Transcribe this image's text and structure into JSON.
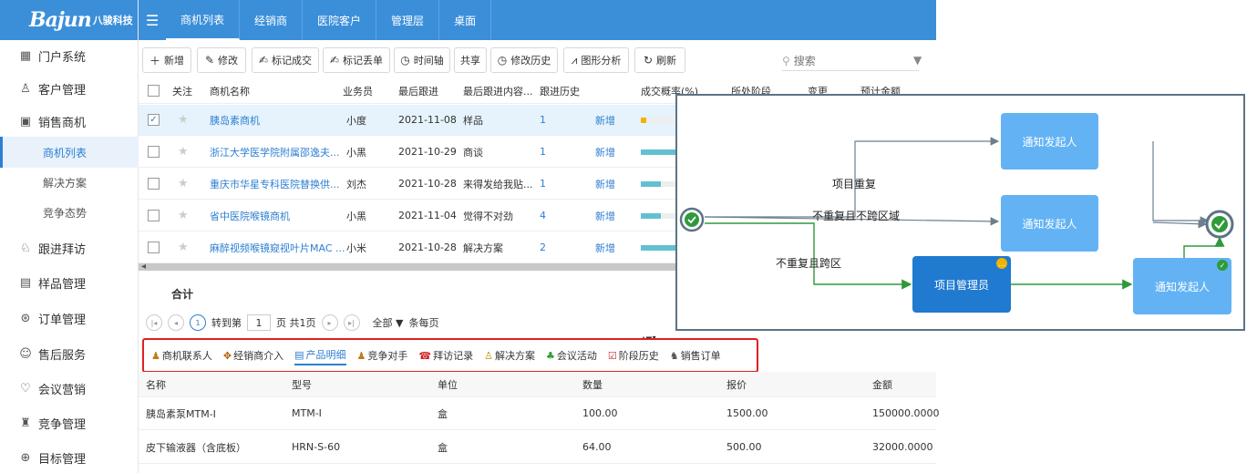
{
  "logo": {
    "brand": "Bajun",
    "brand_cn": "八骏科技"
  },
  "sidebar": {
    "items": [
      {
        "label": "门户系统",
        "icon": "grid-icon"
      },
      {
        "label": "客户管理",
        "icon": "user-icon"
      },
      {
        "label": "销售商机",
        "icon": "opportunity-icon"
      },
      {
        "label": "跟进拜访",
        "icon": "visit-icon"
      },
      {
        "label": "样品管理",
        "icon": "sample-icon"
      },
      {
        "label": "订单管理",
        "icon": "order-icon"
      },
      {
        "label": "售后服务",
        "icon": "service-icon"
      },
      {
        "label": "会议营销",
        "icon": "heart-icon"
      },
      {
        "label": "竞争管理",
        "icon": "compete-icon"
      },
      {
        "label": "目标管理",
        "icon": "target-icon"
      }
    ],
    "subitems": [
      {
        "label": "商机列表"
      },
      {
        "label": "解决方案"
      },
      {
        "label": "竞争态势"
      }
    ]
  },
  "topbar": {
    "tabs": [
      "商机列表",
      "经销商",
      "医院客户",
      "管理层",
      "桌面"
    ]
  },
  "toolbar": {
    "buttons": [
      "新增",
      "修改",
      "标记成交",
      "标记丢单",
      "时间轴",
      "共享",
      "修改历史",
      "图形分析",
      "刷新"
    ],
    "search_placeholder": "搜索"
  },
  "grid": {
    "headers": [
      "关注",
      "商机名称",
      "业务员",
      "最后跟进",
      "最后跟进内容...",
      "跟进历史",
      "成交概率(%)",
      "所处阶段",
      "变更",
      "预计金额"
    ],
    "rows": [
      {
        "name": "胰岛素商机",
        "sales": "小度",
        "date": "2021-11-08",
        "content": "样品",
        "history": "1",
        "stage": "新增",
        "probability": 15,
        "checked": true
      },
      {
        "name": "浙江大学医学院附属邵逸夫...",
        "sales": "小黑",
        "date": "2021-10-29",
        "content": "商谈",
        "history": "1",
        "stage": "新增",
        "probability": 100,
        "checked": false
      },
      {
        "name": "重庆市华星专科医院替换供...",
        "sales": "刘杰",
        "date": "2021-10-28",
        "content": "来得发给我贴...",
        "history": "1",
        "stage": "新增",
        "probability": 55,
        "checked": false
      },
      {
        "name": "省中医院喉镜商机",
        "sales": "小黑",
        "date": "2021-11-04",
        "content": "觉得不对劲",
        "history": "4",
        "stage": "新增",
        "probability": 55,
        "checked": false
      },
      {
        "name": "麻醉视频喉镜窥视叶片MAC ...",
        "sales": "小米",
        "date": "2021-10-28",
        "content": "解决方案",
        "history": "2",
        "stage": "新增",
        "probability": 100,
        "checked": false
      }
    ]
  },
  "summary": {
    "label": "合计"
  },
  "pager": {
    "current": "1",
    "goto_label": "转到第",
    "goto_value": "1",
    "pages_label": "页 共1页",
    "size_value": "全部",
    "size_label": "条每页"
  },
  "detail_tabs": [
    "商机联系人",
    "经销商介入",
    "产品明细",
    "竞争对手",
    "拜访记录",
    "解决方案",
    "会议活动",
    "阶段历史",
    "销售订单"
  ],
  "detail": {
    "headers": [
      "名称",
      "型号",
      "单位",
      "数量",
      "报价",
      "金额"
    ],
    "rows": [
      [
        "胰岛素泵MTM-I",
        "MTM-I",
        "盒",
        "100.00",
        "1500.00",
        "150000.0000"
      ],
      [
        "皮下输液器（含底板）",
        "HRN-S-60",
        "盒",
        "64.00",
        "500.00",
        "32000.0000"
      ]
    ]
  },
  "flow": {
    "nodes": {
      "notify1": "通知发起人",
      "notify2": "通知发起人",
      "manager": "项目管理员",
      "notify3": "通知发起人"
    },
    "labels": {
      "repeat": "项目重复",
      "no_repeat_no_cross": "不重复且不跨区域",
      "no_repeat_cross": "不重复且跨区"
    },
    "colors": {
      "gray_line": "#6b7f8f",
      "green_line": "#2e9a3a",
      "light_node": "#63b3f4",
      "dark_node": "#1f7ad0"
    }
  }
}
